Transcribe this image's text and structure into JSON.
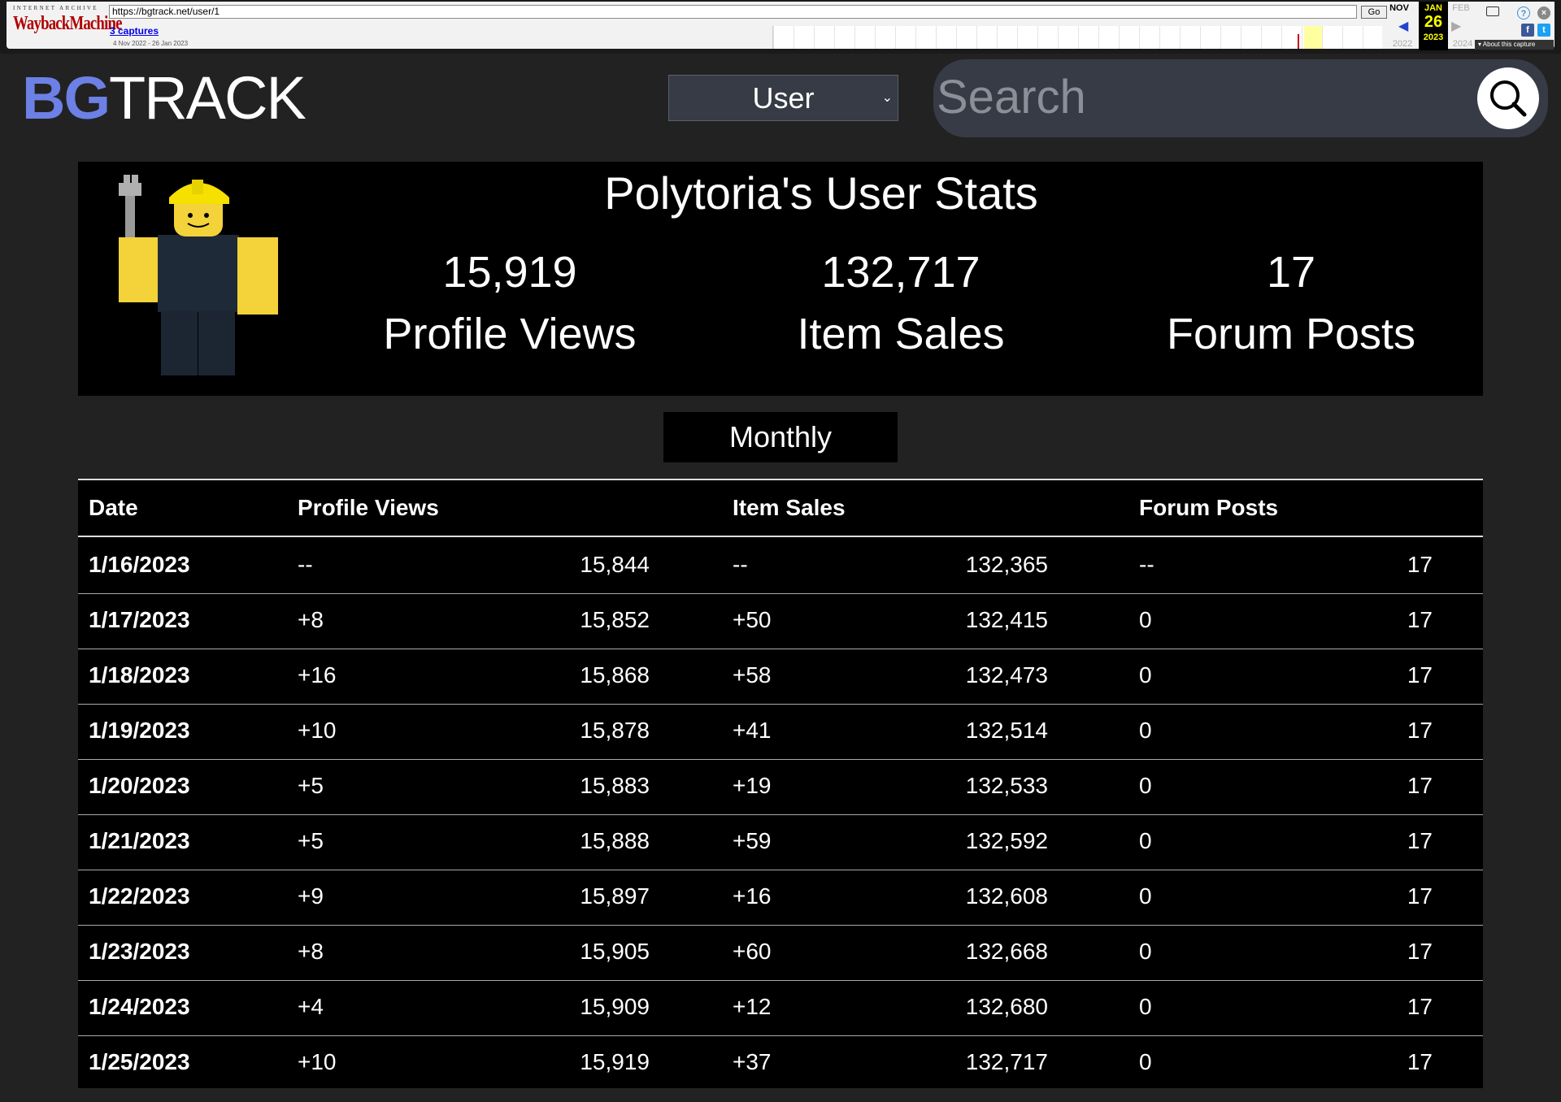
{
  "wayback": {
    "logo_top": "INTERNET ARCHIVE",
    "logo_main": "WaybackMachine",
    "url": "https://bgtrack.net/user/1",
    "go": "Go",
    "captures": "3 captures",
    "range": "4 Nov 2022 - 26 Jan 2023",
    "prev_month": "NOV",
    "cur_month": "JAN",
    "cur_day": "26",
    "next_month": "FEB",
    "prev_year": "2022",
    "cur_year": "2023",
    "next_year": "2024",
    "about": "About this capture"
  },
  "header": {
    "logo_bg": "BG",
    "logo_track": "TRACK",
    "select_value": "User",
    "search_placeholder": "Search"
  },
  "stats": {
    "title": "Polytoria's User Stats",
    "items": [
      {
        "value": "15,919",
        "label": "Profile Views"
      },
      {
        "value": "132,717",
        "label": "Item Sales"
      },
      {
        "value": "17",
        "label": "Forum Posts"
      }
    ]
  },
  "period_button": "Monthly",
  "table": {
    "headers": [
      "Date",
      "Profile Views",
      "Item Sales",
      "Forum Posts"
    ],
    "rows": [
      {
        "date": "1/16/2023",
        "pv_delta": "--",
        "pv": "15,844",
        "is_delta": "--",
        "is": "132,365",
        "fp_delta": "--",
        "fp": "17"
      },
      {
        "date": "1/17/2023",
        "pv_delta": "+8",
        "pv": "15,852",
        "is_delta": "+50",
        "is": "132,415",
        "fp_delta": "0",
        "fp": "17"
      },
      {
        "date": "1/18/2023",
        "pv_delta": "+16",
        "pv": "15,868",
        "is_delta": "+58",
        "is": "132,473",
        "fp_delta": "0",
        "fp": "17"
      },
      {
        "date": "1/19/2023",
        "pv_delta": "+10",
        "pv": "15,878",
        "is_delta": "+41",
        "is": "132,514",
        "fp_delta": "0",
        "fp": "17"
      },
      {
        "date": "1/20/2023",
        "pv_delta": "+5",
        "pv": "15,883",
        "is_delta": "+19",
        "is": "132,533",
        "fp_delta": "0",
        "fp": "17"
      },
      {
        "date": "1/21/2023",
        "pv_delta": "+5",
        "pv": "15,888",
        "is_delta": "+59",
        "is": "132,592",
        "fp_delta": "0",
        "fp": "17"
      },
      {
        "date": "1/22/2023",
        "pv_delta": "+9",
        "pv": "15,897",
        "is_delta": "+16",
        "is": "132,608",
        "fp_delta": "0",
        "fp": "17"
      },
      {
        "date": "1/23/2023",
        "pv_delta": "+8",
        "pv": "15,905",
        "is_delta": "+60",
        "is": "132,668",
        "fp_delta": "0",
        "fp": "17"
      },
      {
        "date": "1/24/2023",
        "pv_delta": "+4",
        "pv": "15,909",
        "is_delta": "+12",
        "is": "132,680",
        "fp_delta": "0",
        "fp": "17"
      },
      {
        "date": "1/25/2023",
        "pv_delta": "+10",
        "pv": "15,919",
        "is_delta": "+37",
        "is": "132,717",
        "fp_delta": "0",
        "fp": "17"
      }
    ]
  },
  "colors": {
    "page_bg": "#222222",
    "panel_bg": "#000000",
    "logo_accent": "#6d80e6",
    "input_bg": "#363b45"
  }
}
